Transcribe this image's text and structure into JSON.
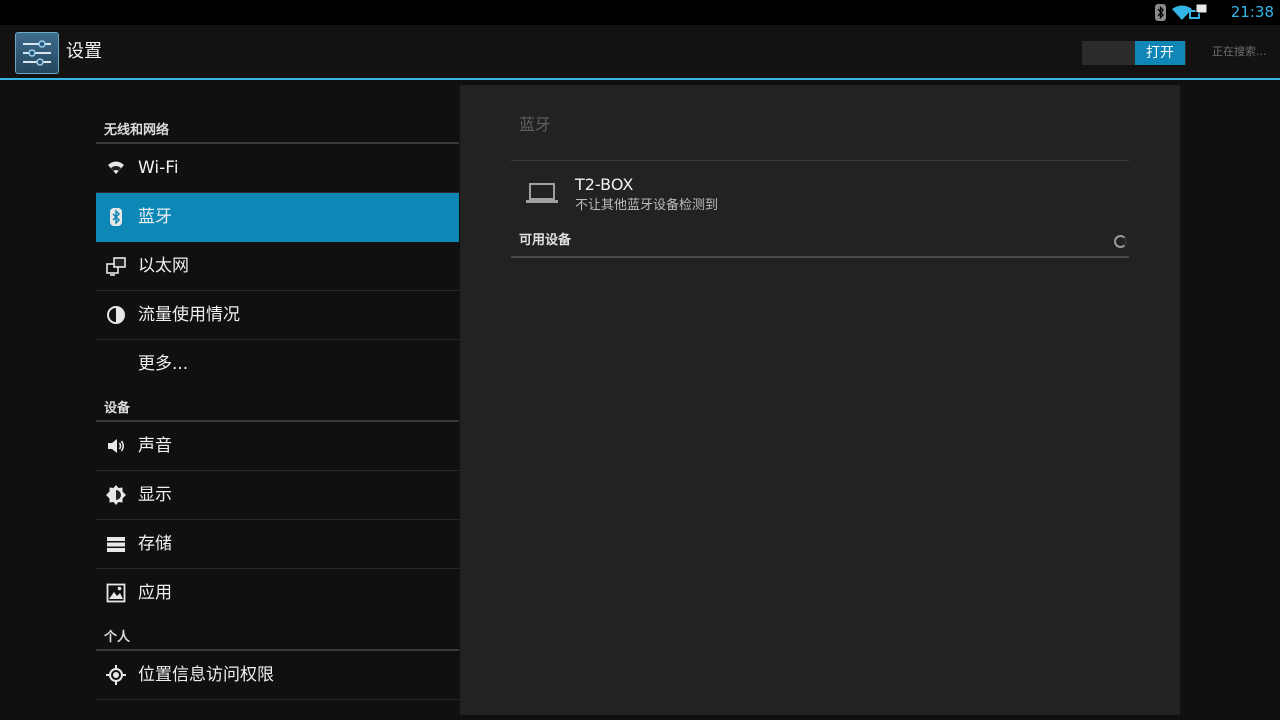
{
  "status_bar": {
    "time": "21:38",
    "icons": [
      "bluetooth-icon",
      "wifi-icon",
      "ethernet-icon"
    ]
  },
  "action_bar": {
    "title": "设置",
    "toggle_label": "打开",
    "status_text": "正在搜索..."
  },
  "sidebar": {
    "sections": [
      {
        "header": "无线和网络",
        "items": [
          {
            "label": "Wi-Fi",
            "icon": "wifi-icon"
          },
          {
            "label": "蓝牙",
            "icon": "bluetooth-icon",
            "selected": true
          },
          {
            "label": "以太网",
            "icon": "ethernet-icon"
          },
          {
            "label": "流量使用情况",
            "icon": "data-usage-icon"
          },
          {
            "label": "更多...",
            "icon": ""
          }
        ]
      },
      {
        "header": "设备",
        "items": [
          {
            "label": "声音",
            "icon": "sound-icon"
          },
          {
            "label": "显示",
            "icon": "display-icon"
          },
          {
            "label": "存储",
            "icon": "storage-icon"
          },
          {
            "label": "应用",
            "icon": "apps-icon"
          }
        ]
      },
      {
        "header": "个人",
        "items": [
          {
            "label": "位置信息访问权限",
            "icon": "location-icon"
          }
        ]
      }
    ]
  },
  "bluetooth": {
    "title": "蓝牙",
    "device_name": "T2-BOX",
    "device_status": "不让其他蓝牙设备检测到",
    "available_header": "可用设备"
  },
  "colors": {
    "accent": "#33b5e5",
    "selected": "#0d87b6",
    "pane": "#222222"
  }
}
